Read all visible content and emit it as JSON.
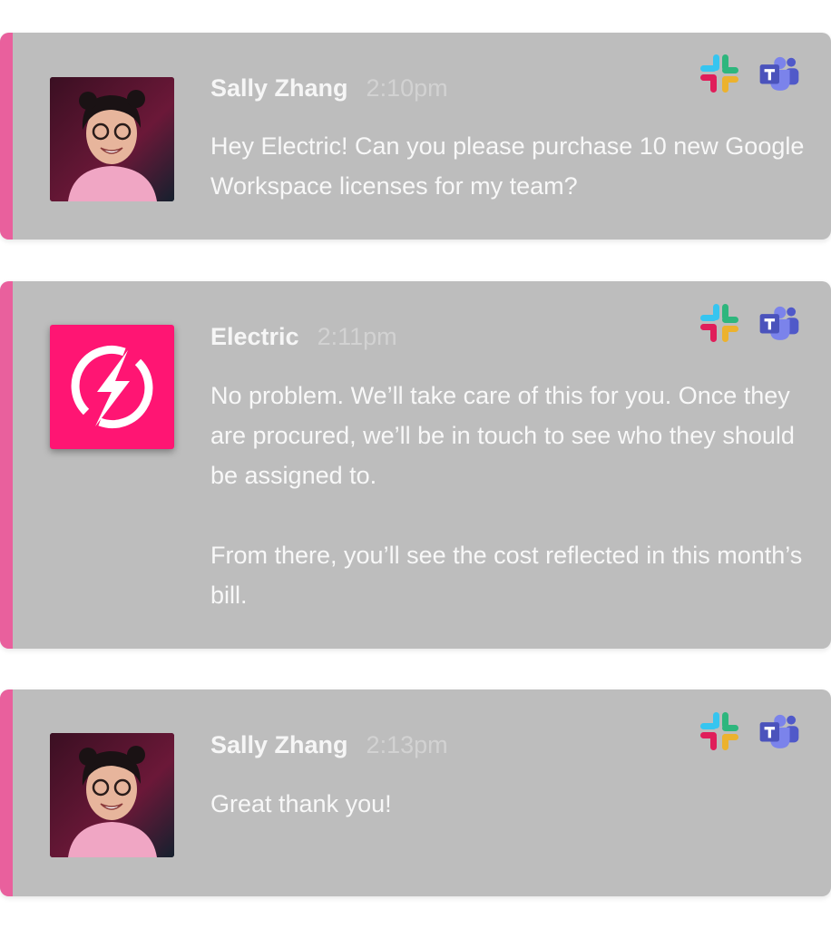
{
  "messages": [
    {
      "sender": "Sally Zhang",
      "time": "2:10pm",
      "avatar": "person-photo",
      "paragraphs": [
        "Hey Electric! Can you please purchase 10 new Google Workspace licenses for my team?"
      ]
    },
    {
      "sender": "Electric",
      "time": "2:11pm",
      "avatar": "lightning-logo",
      "paragraphs": [
        "No problem. We’ll take care of this for you. Once they are procured, we’ll be in touch to see who they should be assigned to.",
        "From there, you’ll see the cost reflected in this month’s bill."
      ]
    },
    {
      "sender": "Sally Zhang",
      "time": "2:13pm",
      "avatar": "person-photo",
      "paragraphs": [
        "Great thank you!"
      ]
    }
  ],
  "platform_icons": [
    "slack-icon",
    "microsoft-teams-icon"
  ],
  "colors": {
    "accent_bar": "#e9609d",
    "electric_brand": "#ff1573",
    "card_background": "#bdbdbd"
  }
}
